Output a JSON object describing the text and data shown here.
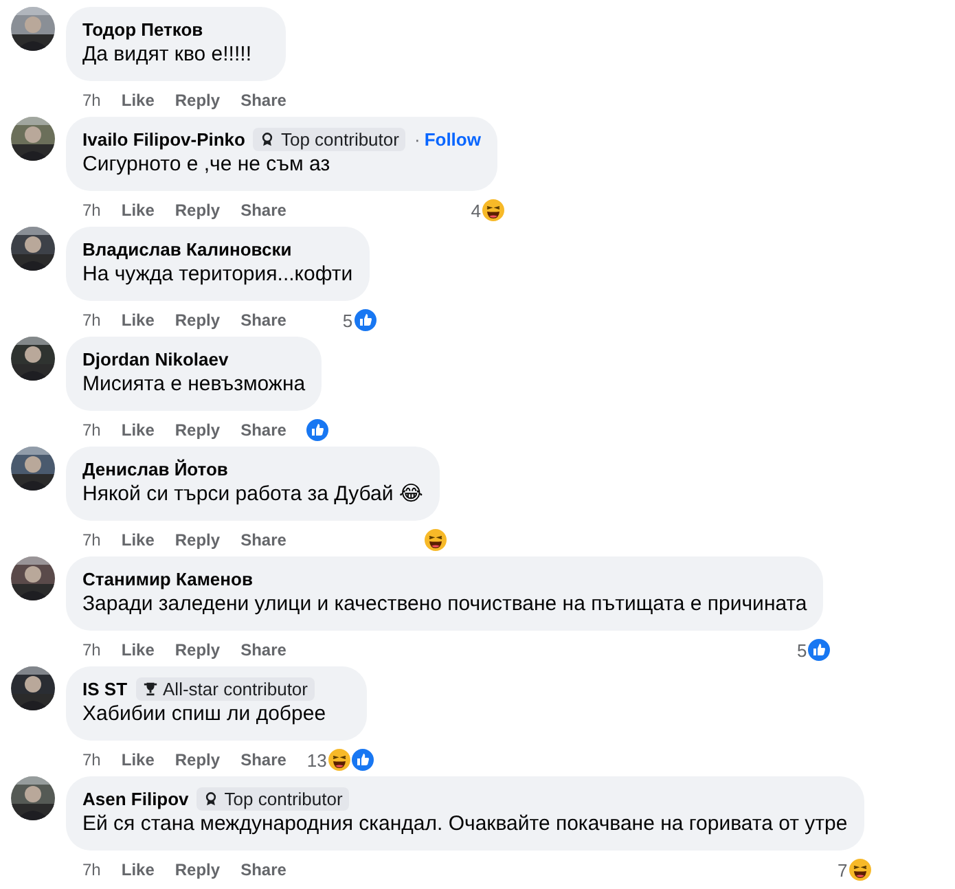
{
  "comments": [
    {
      "author": "Тодор Петков",
      "text": "Да видят кво е!!!!!",
      "time": "7h",
      "actions": [
        "Like",
        "Reply",
        "Share"
      ]
    },
    {
      "author": "Ivailo Filipov-Pinko",
      "badge": {
        "kind": "top",
        "label": "Top contributor"
      },
      "separator": "·",
      "follow": "Follow",
      "text": "Сигурното е ,че не съм аз",
      "time": "7h",
      "actions": [
        "Like",
        "Reply",
        "Share"
      ],
      "reaction_count": "4",
      "reactions": [
        {
          "kind": "haha"
        }
      ]
    },
    {
      "author": "Владислав Калиновски",
      "text": "На чужда територия...кофти",
      "time": "7h",
      "actions": [
        "Like",
        "Reply",
        "Share"
      ],
      "reaction_count": "5",
      "reactions": [
        {
          "kind": "like"
        }
      ]
    },
    {
      "author": "Djordan Nikolaev",
      "text": "Мисията е невъзможна",
      "time": "7h",
      "actions": [
        "Like",
        "Reply",
        "Share"
      ],
      "reactions": [
        {
          "kind": "like"
        }
      ]
    },
    {
      "author": "Денислав Йотов",
      "text": "Някой си търси работа за Дубай 😂",
      "time": "7h",
      "actions": [
        "Like",
        "Reply",
        "Share"
      ],
      "reactions": [
        {
          "kind": "haha"
        }
      ]
    },
    {
      "author": "Станимир Каменов",
      "text": "Заради заледени улици и качествено почистване на пътищата е причината",
      "time": "7h",
      "actions": [
        "Like",
        "Reply",
        "Share"
      ],
      "reaction_count": "5",
      "reactions": [
        {
          "kind": "like"
        }
      ]
    },
    {
      "author": "IS ST",
      "badge": {
        "kind": "allstar",
        "label": "All-star contributor"
      },
      "text": "Хабибии спиш ли добрее",
      "time": "7h",
      "actions": [
        "Like",
        "Reply",
        "Share"
      ],
      "reaction_count": "13",
      "reactions": [
        {
          "kind": "haha"
        },
        {
          "kind": "like"
        }
      ]
    },
    {
      "author": "Asen Filipov",
      "badge": {
        "kind": "top",
        "label": "Top contributor"
      },
      "text": "Ей ся стана международния скандал. Очаквайте покачване на горивата от утре",
      "time": "7h",
      "actions": [
        "Like",
        "Reply",
        "Share"
      ],
      "reaction_count": "7",
      "reactions": [
        {
          "kind": "haha"
        }
      ]
    }
  ]
}
